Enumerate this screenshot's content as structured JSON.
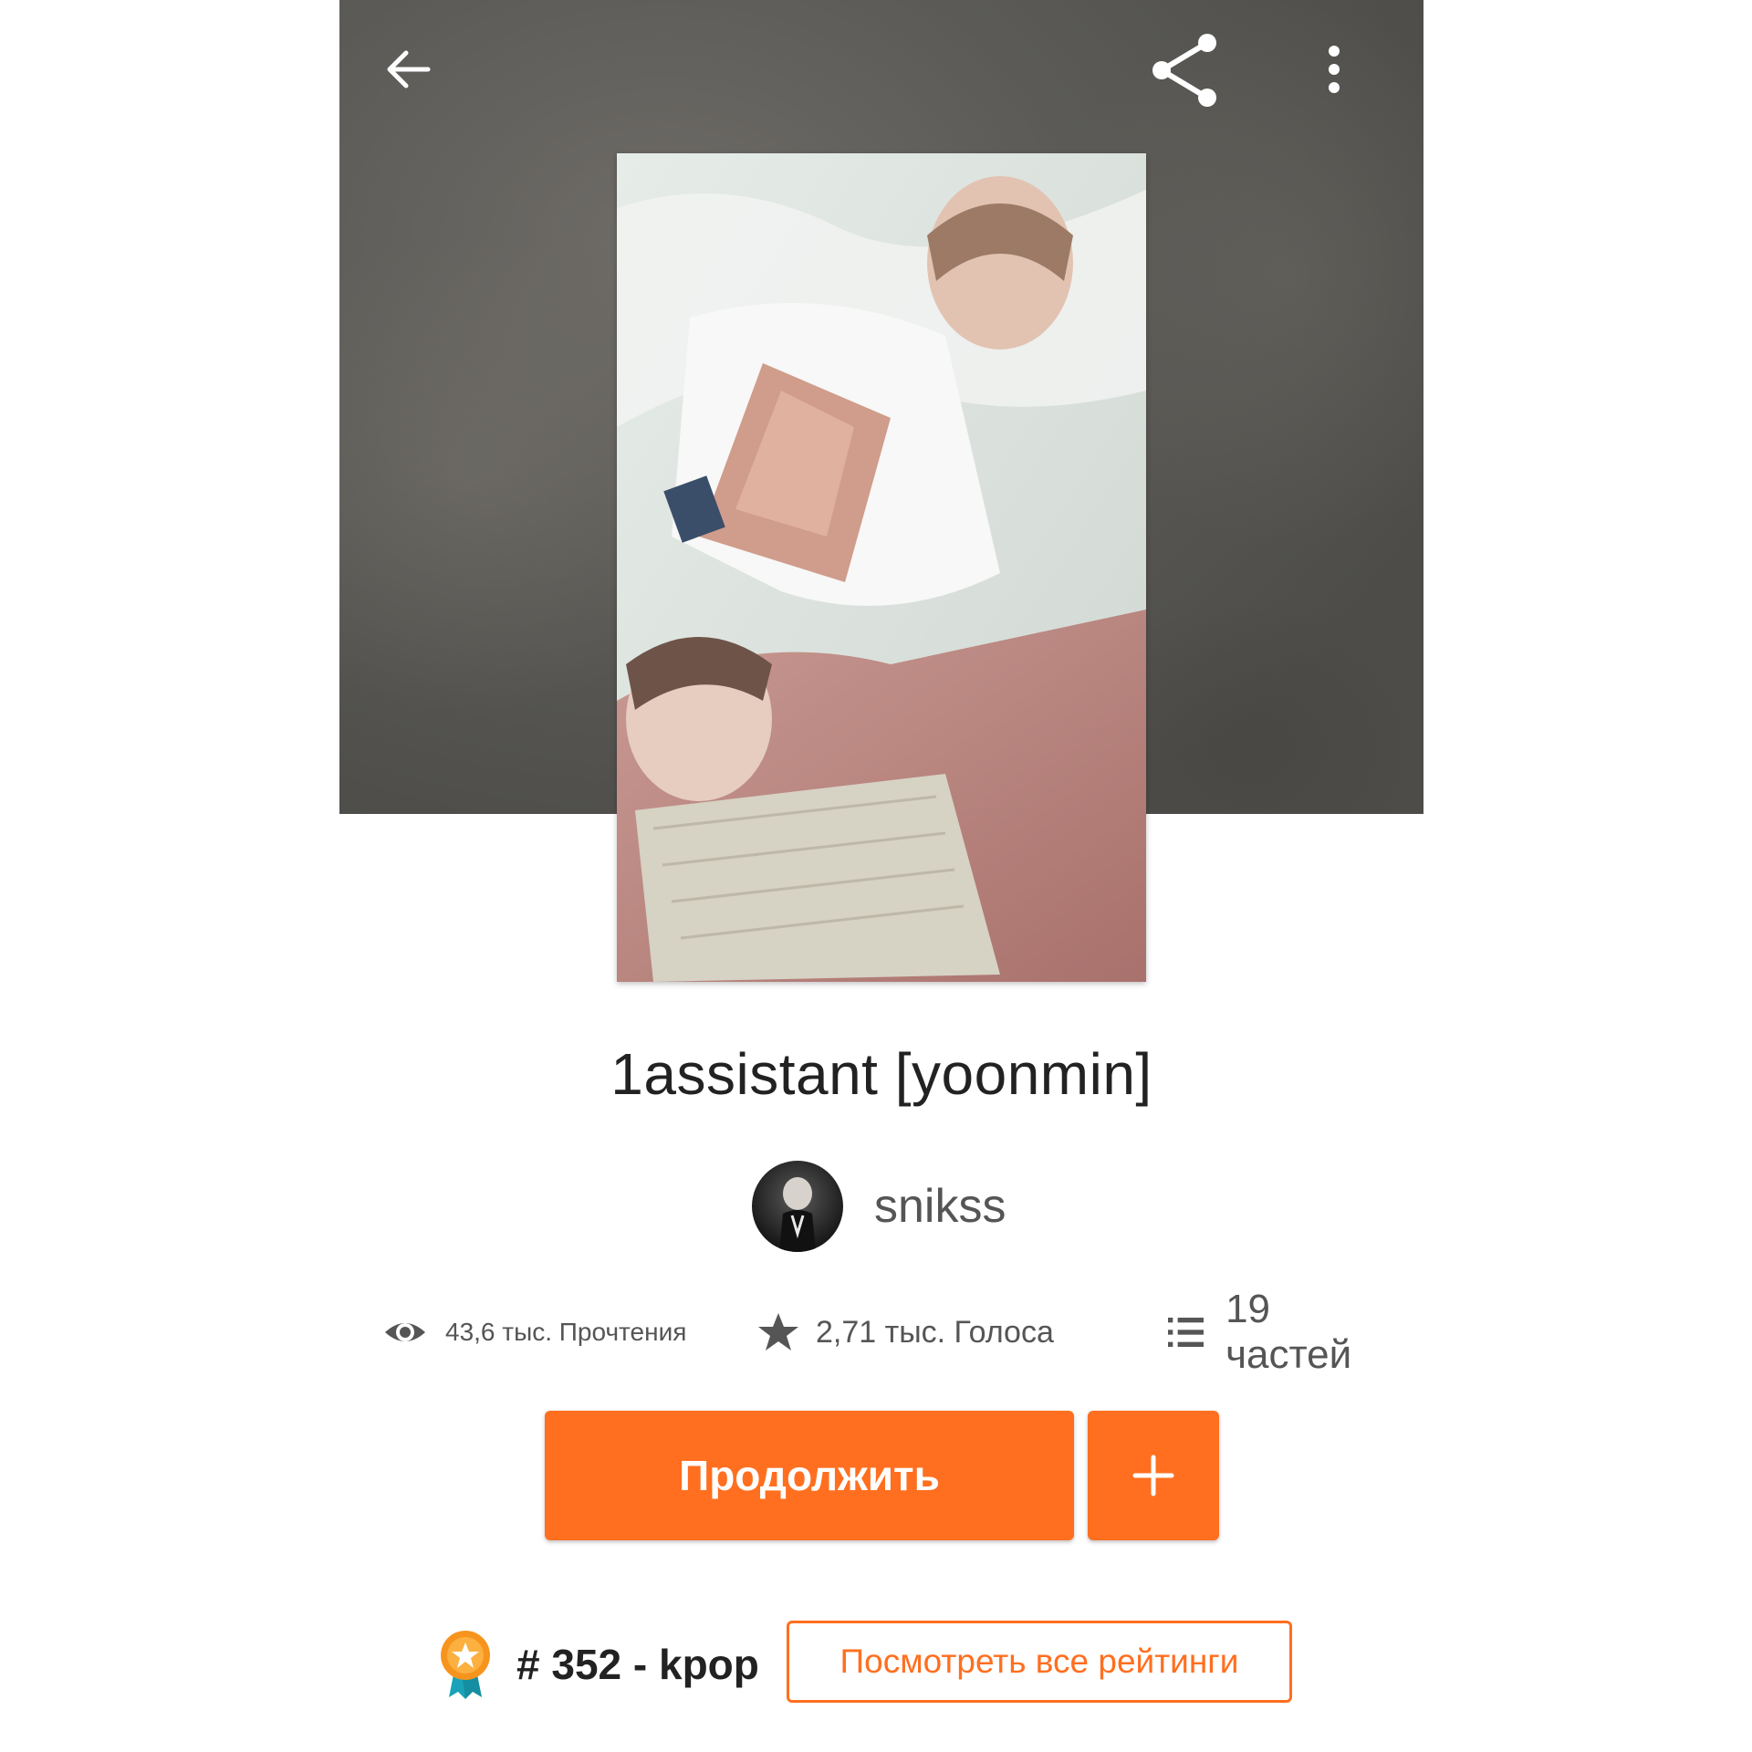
{
  "toolbar": {
    "back_icon": "arrow-left-icon",
    "share_icon": "share-icon",
    "more_icon": "more-vertical-icon"
  },
  "story": {
    "title": "1assistant [yoonmin]",
    "author": "snikss"
  },
  "stats": {
    "reads": "43,6 тыс. Прочтения",
    "votes": "2,71 тыс. Голоса",
    "parts": "19 частей"
  },
  "actions": {
    "continue_label": "Продолжить",
    "add_label": "+"
  },
  "ranking": {
    "rank_text": "# 352 - kpop",
    "view_all_label": "Посмотреть все рейтинги"
  },
  "colors": {
    "accent": "#ff6f1f",
    "header_bg": "#555451",
    "text_primary": "#222222",
    "text_secondary": "#555555"
  }
}
